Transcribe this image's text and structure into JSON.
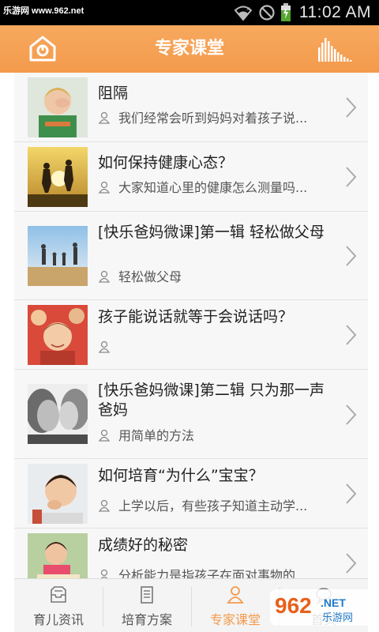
{
  "statusbar": {
    "watermark": "乐游网 www.962.net",
    "time": "11:02 AM"
  },
  "header": {
    "title": "专家课堂",
    "left_icon": "home-icon",
    "right_icon": "bars-icon"
  },
  "articles": [
    {
      "title": "阻隔",
      "summary": "我们经常会听到妈妈对着孩子说..."
    },
    {
      "title": "如何保持健康心态？",
      "summary": "大家知道心里的健康怎么测量吗..."
    },
    {
      "title": "[快乐爸妈微课]第一辑 轻松做父母",
      "summary": "轻松做父母"
    },
    {
      "title": "孩子能说话就等于会说话吗？",
      "summary": ""
    },
    {
      "title": "[快乐爸妈微课]第二辑 只为那一声爸妈",
      "summary": "用简单的方法"
    },
    {
      "title": "如何培育“为什么”宝宝？",
      "summary": "上学以后，有些孩子知道主动学..."
    },
    {
      "title": "成绩好的秘密",
      "summary": "分析能力是指孩子在面对事物的"
    }
  ],
  "tabs": [
    {
      "label": "育儿资讯",
      "icon": "inbox-icon",
      "active": false
    },
    {
      "label": "培育方案",
      "icon": "document-icon",
      "active": false
    },
    {
      "label": "专家课堂",
      "icon": "expert-icon",
      "active": true
    },
    {
      "label": "首页",
      "icon": "chat-icon",
      "active": false
    }
  ],
  "watermark_bottom": "962.NET 乐游网",
  "colors": {
    "accent": "#f39a4c",
    "header": "#f5a155",
    "text": "#222222",
    "subtext": "#555555"
  }
}
